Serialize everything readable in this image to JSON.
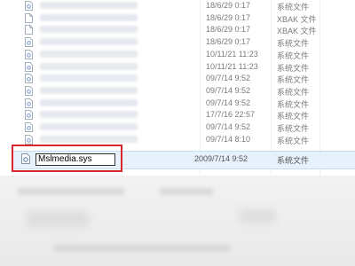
{
  "rows": [
    {
      "date": "18/6/29 0:17",
      "type": "系统文件",
      "icon": "sys-file-icon"
    },
    {
      "date": "18/6/29 0:17",
      "type": "XBAK 文件",
      "icon": "blank-file-icon"
    },
    {
      "date": "18/6/29 0:17",
      "type": "XBAK 文件",
      "icon": "blank-file-icon"
    },
    {
      "date": "18/6/29 0:17",
      "type": "系统文件",
      "icon": "sys-file-icon"
    },
    {
      "date": "10/11/21 11:23",
      "type": "系统文件",
      "icon": "sys-file-icon"
    },
    {
      "date": "10/11/21 11:23",
      "type": "系统文件",
      "icon": "sys-file-icon"
    },
    {
      "date": "09/7/14 9:52",
      "type": "系统文件",
      "icon": "sys-file-icon"
    },
    {
      "date": "09/7/14 9:52",
      "type": "系统文件",
      "icon": "sys-file-icon"
    },
    {
      "date": "09/7/14 9:52",
      "type": "系统文件",
      "icon": "sys-file-icon"
    },
    {
      "date": "17/7/16 22:57",
      "type": "系统文件",
      "icon": "sys-file-icon"
    },
    {
      "date": "09/7/14 9:52",
      "type": "系统文件",
      "icon": "sys-file-icon"
    },
    {
      "date": "09/7/14 8:10",
      "type": "系统文件",
      "icon": "sys-file-icon"
    }
  ],
  "selected": {
    "name": "Mslmedia.sys",
    "date": "2009/7/14 9:52",
    "type": "系统文件",
    "icon": "sys-file-icon"
  },
  "colors": {
    "highlight": "#d7262e",
    "selection": "#e7f1fb"
  }
}
